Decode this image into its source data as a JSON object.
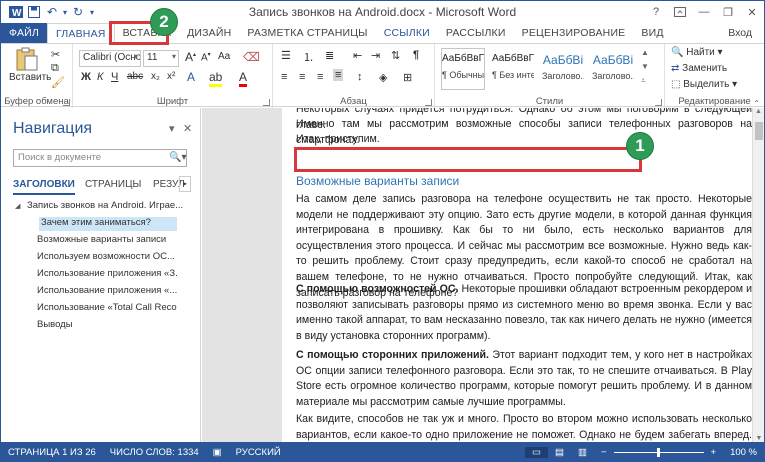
{
  "window": {
    "title": "Запись звонков на Android.docx - Microsoft Word",
    "help": "?",
    "signin": "Вход"
  },
  "tabs": [
    "ФАЙЛ",
    "ГЛАВНАЯ",
    "ВСТАВКА",
    "ДИЗАЙН",
    "РАЗМЕТКА СТРАНИЦЫ",
    "ССЫЛКИ",
    "РАССЫЛКИ",
    "РЕЦЕНЗИРОВАНИЕ",
    "ВИД"
  ],
  "ribbon": {
    "clipboard": {
      "paste_label": "Вставить",
      "group_label": "Буфер обмена"
    },
    "font": {
      "name": "Calibri (Осно",
      "size": "11",
      "group_label": "Шрифт",
      "bold": "Ж",
      "italic": "К",
      "underline": "Ч",
      "grow": "A",
      "shrink": "A",
      "case": "Aa",
      "color_a": "A"
    },
    "paragraph": {
      "group_label": "Абзац"
    },
    "styles": {
      "group_label": "Стили",
      "items": [
        {
          "sample": "АаБбВвГг,",
          "name": "¶ Обычный"
        },
        {
          "sample": "АаБбВвГг,",
          "name": "¶ Без инте..."
        },
        {
          "sample": "АаБбВі",
          "name": "Заголово..."
        },
        {
          "sample": "АаБбВі",
          "name": "Заголово..."
        }
      ]
    },
    "editing": {
      "find": "Найти",
      "replace": "Заменить",
      "select": "Выделить",
      "group_label": "Редактирование"
    }
  },
  "navigation": {
    "title": "Навигация",
    "search_placeholder": "Поиск в документе",
    "tabs": [
      "ЗАГОЛОВКИ",
      "СТРАНИЦЫ",
      "РЕЗУЛ"
    ],
    "tree": [
      "Запись звонков на Android. Играе...",
      "Зачем этим заниматься?",
      "Возможные варианты записи",
      "Используем возможности ОС...",
      "Использование приложения «З...",
      "Использование приложения «...",
      "Использование «Total Call Reco...",
      "Выводы"
    ]
  },
  "document": {
    "p0": "Некоторых случаях придется потрудиться. Однако об этом мы поговорим в следующей главе.",
    "p1a": "Именно там мы рассмотрим возможные способы записи телефонных разговоров на смартфонах.",
    "p1b": "Итак, приступим.",
    "heading": "Возможные варианты записи",
    "p2": "На самом деле запись разговора на телефоне осуществить не так просто. Некоторые модели не поддерживают эту опцию. Зато есть другие модели, в которой данная функция интегрирована в прошивку. Как бы то ни было, есть несколько вариантов для осуществления этого процесса. И сейчас мы рассмотрим все возможные. Нужно ведь как-то решить проблему. Стоит сразу предупредить, если какой-то способ не сработал на вашем телефоне, то не нужно отчаиваться. Просто попробуйте следующий. Итак, как записать разговор на телефоне?",
    "p3_bold": "С помощью возможностей ОС.",
    "p3": " Некоторые прошивки обладают встроенным рекордером и позволяют записывать разговоры прямо из системного меню во время звонка. Если у вас именно такой аппарат, то вам несказанно повезло, так как ничего делать не нужно (имеется в виду установка сторонних программ).",
    "p4_bold": "С помощью сторонних приложений.",
    "p4": " Этот вариант подходит тем, у кого нет в настройках ОС опции записи телефонного разговора. Если это так, то не спешите отчаиваться. В Play Store есть огромное количество программ, которые помогут решить проблему. И в данном материале мы рассмотрим самые лучшие программы.",
    "p5": "Как видите, способов не так уж и много. Просто во втором можно использовать несколько вариантов, если какое-то одно приложение не поможет. Однако не будем забегать вперед. Для"
  },
  "status": {
    "page": "СТРАНИЦА 1 ИЗ 26",
    "words": "ЧИСЛО СЛОВ: 1334",
    "lang": "РУССКИЙ",
    "zoom": "100 %"
  },
  "annotations": {
    "badge1": "1",
    "badge2": "2"
  },
  "colors": {
    "accent": "#2b579a",
    "annotation_red": "#d9383a",
    "annotation_green": "#2e9b57"
  }
}
